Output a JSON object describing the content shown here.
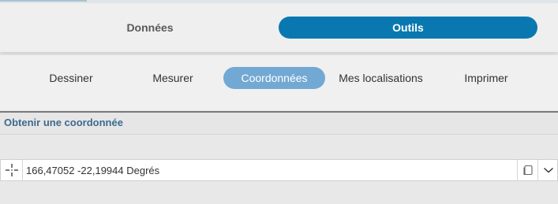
{
  "main_tabs": [
    {
      "label": "Données",
      "active": false
    },
    {
      "label": "Outils",
      "active": true
    }
  ],
  "sub_tabs": [
    {
      "label": "Dessiner",
      "active": false
    },
    {
      "label": "Mesurer",
      "active": false
    },
    {
      "label": "Coordonnées",
      "active": true
    },
    {
      "label": "Mes localisations",
      "active": false
    },
    {
      "label": "Imprimer",
      "active": false
    }
  ],
  "section": {
    "title": "Obtenir une coordonnée"
  },
  "coordinate": {
    "value": "166,47052 -22,19944 Degrés"
  },
  "icons": {
    "crosshair": "crosshair-icon",
    "copy": "copy-icon",
    "dropdown": "chevron-down-icon"
  },
  "colors": {
    "accent": "#0a78b0",
    "sub_tab_active": "#72a9d4",
    "section_title": "#3d6b8f"
  }
}
